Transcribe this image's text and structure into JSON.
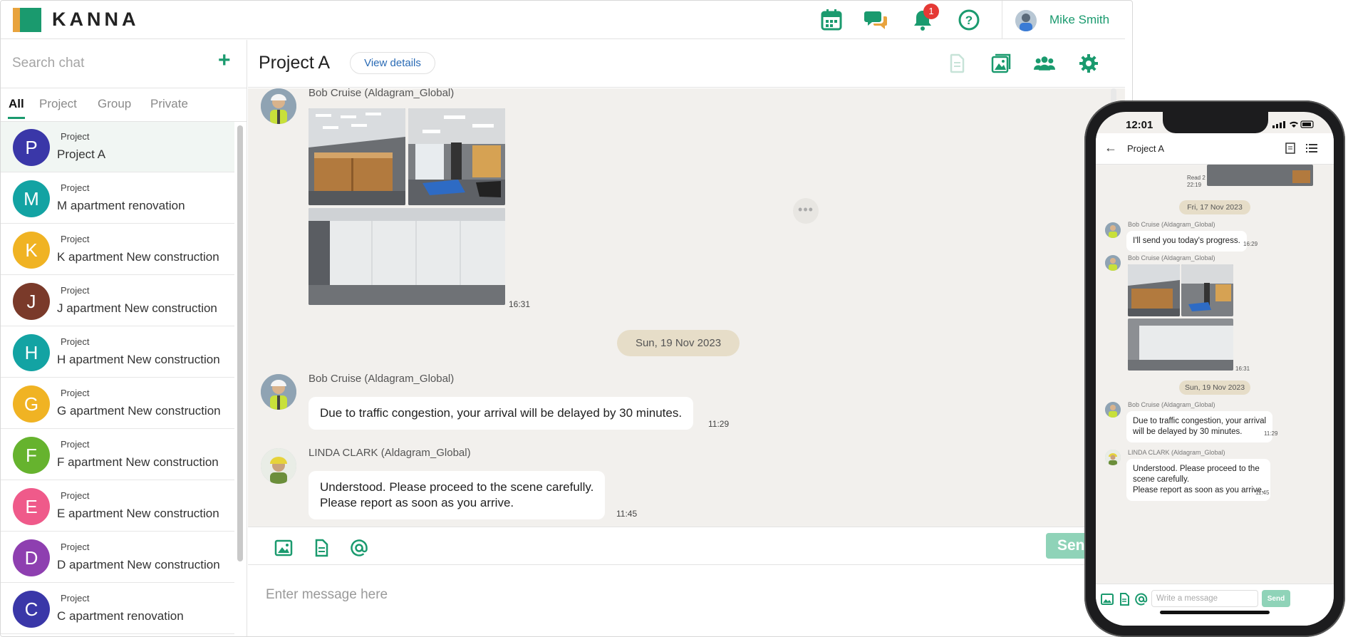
{
  "app": {
    "logo_text": "KANNA"
  },
  "topbar": {
    "notification_count": "1",
    "user_name": "Mike Smith"
  },
  "sidebar": {
    "search_placeholder": "Search chat",
    "tabs": [
      "All",
      "Project",
      "Group",
      "Private"
    ],
    "active_tab": "All",
    "chats": [
      {
        "initial": "P",
        "type": "Project",
        "name": "Project A",
        "color": "#3a37a8",
        "selected": true
      },
      {
        "initial": "M",
        "type": "Project",
        "name": "M apartment renovation",
        "color": "#13a3a3"
      },
      {
        "initial": "K",
        "type": "Project",
        "name": "K apartment New construction",
        "color": "#f0b323"
      },
      {
        "initial": "J",
        "type": "Project",
        "name": "J apartment New construction",
        "color": "#7a3a2a"
      },
      {
        "initial": "H",
        "type": "Project",
        "name": "H apartment New construction",
        "color": "#13a3a3"
      },
      {
        "initial": "G",
        "type": "Project",
        "name": "G apartment New construction",
        "color": "#f0b323"
      },
      {
        "initial": "F",
        "type": "Project",
        "name": "F apartment New construction",
        "color": "#66b32e"
      },
      {
        "initial": "E",
        "type": "Project",
        "name": "E apartment New construction",
        "color": "#ef5a8a"
      },
      {
        "initial": "D",
        "type": "Project",
        "name": "D apartment New construction",
        "color": "#8e3fb0"
      },
      {
        "initial": "C",
        "type": "Project",
        "name": "C apartment renovation",
        "color": "#3a37a8"
      }
    ]
  },
  "chat": {
    "title": "Project A",
    "view_details": "View details",
    "messages": [
      {
        "sender": "Bob Cruise (Aldagram_Global)",
        "time": "16:31",
        "kind": "photos"
      },
      {
        "date": "Sun, 19 Nov 2023"
      },
      {
        "sender": "Bob Cruise (Aldagram_Global)",
        "lines": [
          "Due to traffic congestion, your arrival will be delayed by 30 minutes."
        ],
        "time": "11:29"
      },
      {
        "sender": "LINDA CLARK (Aldagram_Global)",
        "lines": [
          "Understood. Please proceed to the scene carefully.",
          "Please report as soon as you arrive."
        ],
        "time": "11:45"
      }
    ],
    "input_placeholder": "Enter message here",
    "send_label": "Send"
  },
  "phone": {
    "status_time": "12:01",
    "title": "Project A",
    "read_label": "Read 2",
    "read_time": "22:19",
    "date_1": "Fri, 17 Nov 2023",
    "msg1_sender": "Bob Cruise (Aldagram_Global)",
    "msg1_text": "I'll send you today's progress.",
    "msg1_time": "16:29",
    "msg2_sender": "Bob Cruise (Aldagram_Global)",
    "msg2_time": "16:31",
    "date_2": "Sun, 19 Nov 2023",
    "msg3_sender": "Bob Cruise (Aldagram_Global)",
    "msg3_line1": "Due to traffic congestion, your arrival",
    "msg3_line2": "will be delayed by 30 minutes.",
    "msg3_time": "11:29",
    "msg4_sender": "LINDA CLARK (Aldagram_Global)",
    "msg4_line1": "Understood. Please proceed to the",
    "msg4_line2": "scene carefully.",
    "msg4_line3": "Please report as soon as you arrive.",
    "msg4_time": "11:45",
    "input_placeholder": "Write a message",
    "send_label": "Send"
  },
  "colors": {
    "brand": "#1a9a6e",
    "send_disabled": "#8fd3b8",
    "badge": "#e53935",
    "date_pill": "#e6ddc8"
  },
  "icons": [
    "calendar-icon",
    "chat-bubbles-icon",
    "bell-icon",
    "help-icon",
    "document-icon",
    "gallery-icon",
    "members-icon",
    "settings-icon",
    "image-icon",
    "file-icon",
    "mention-icon"
  ]
}
